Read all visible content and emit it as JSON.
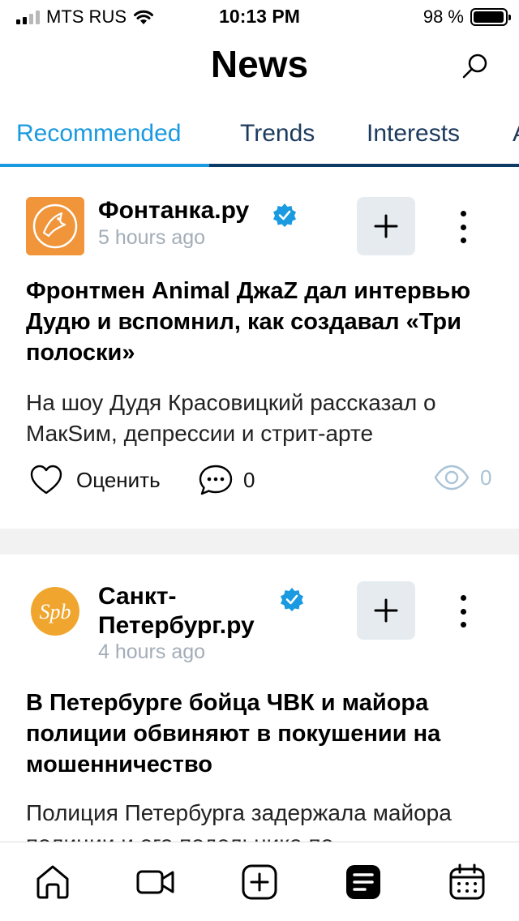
{
  "status_bar": {
    "carrier": "MTS RUS",
    "time": "10:13 PM",
    "battery": "98 %",
    "battery_level": 0.98
  },
  "header": {
    "title": "News",
    "search_icon": "search-icon"
  },
  "tabs": [
    {
      "label": "Recommended",
      "active": true
    },
    {
      "label": "Trends",
      "active": false
    },
    {
      "label": "Interests",
      "active": false
    },
    {
      "label": "A",
      "active": false
    }
  ],
  "articles": [
    {
      "source": "Фонтанка.ру",
      "time_ago": "5 hours ago",
      "verified": true,
      "headline": "Фронтмен Animal ДжаZ дал интервью Дудю и вспомнил, как создавал «Три полоски»",
      "summary": "На шоу Дудя Красовицкий рассказал о МакSим, депрессии и стрит-арте",
      "like_label": "Оценить",
      "comments": "0",
      "views": "0",
      "avatar_color": "#f0953a"
    },
    {
      "source": "Санкт-Петербург.ру",
      "time_ago": "4 hours ago",
      "verified": true,
      "headline": "В Петербурге бойца ЧВК и майора полиции обвиняют в покушении на мошенничество",
      "summary": "Полиция Петербурга задержала майора полиции и его подельника по",
      "avatar_color": "#f0a62e",
      "avatar_text": "Spb"
    }
  ],
  "tab_bar": [
    "home-icon",
    "video-icon",
    "add-icon",
    "news-feed-icon",
    "calendar-icon"
  ],
  "colors": {
    "accent": "#1a9ae0",
    "tab_text": "#1c3a5e",
    "verified": "#1a9ae0",
    "muted": "#a3adb8"
  }
}
